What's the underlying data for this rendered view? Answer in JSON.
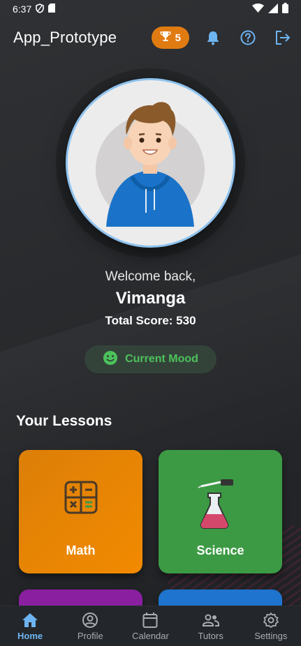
{
  "status_bar": {
    "time": "6:37"
  },
  "app_bar": {
    "title": "App_Prototype",
    "score_badge": "5",
    "icons": [
      "trophy-icon",
      "bell-icon",
      "help-icon",
      "logout-icon"
    ]
  },
  "profile": {
    "welcome": "Welcome back,",
    "name": "Vimanga",
    "total_score": "Total Score: 530"
  },
  "mood": {
    "label": "Current Mood",
    "icon": "smile-icon"
  },
  "lessons": {
    "title": "Your Lessons",
    "items": [
      {
        "label": "Math",
        "color": "#ef8a00",
        "icon": "calculator-icon"
      },
      {
        "label": "Science",
        "color": "#3c9a44",
        "icon": "flask-icon"
      },
      {
        "label": "",
        "color": "#8a1fa0"
      },
      {
        "label": "",
        "color": "#1e74cf"
      }
    ]
  },
  "bottom_nav": {
    "items": [
      {
        "label": "Home",
        "icon": "home-icon",
        "active": true
      },
      {
        "label": "Profile",
        "icon": "profile-icon",
        "active": false
      },
      {
        "label": "Calendar",
        "icon": "calendar-icon",
        "active": false
      },
      {
        "label": "Tutors",
        "icon": "tutors-icon",
        "active": false
      },
      {
        "label": "Settings",
        "icon": "settings-icon",
        "active": false
      }
    ]
  },
  "colors": {
    "accent_blue": "#6fb4f2",
    "score_orange": "#e07b12",
    "mood_green": "#4cc25b"
  }
}
